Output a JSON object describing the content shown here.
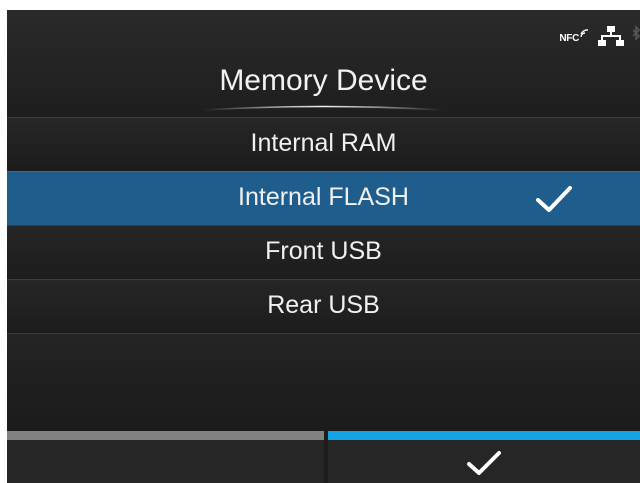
{
  "status_bar": {
    "nfc_label": "NFC",
    "icons": [
      "nfc-icon",
      "network-icon",
      "bluetooth-icon"
    ]
  },
  "header": {
    "title": "Memory Device"
  },
  "device_list": {
    "items": [
      {
        "label": "Internal RAM",
        "selected": false
      },
      {
        "label": "Internal FLASH",
        "selected": true,
        "check_icon": "checkmark-icon"
      },
      {
        "label": "Front USB",
        "selected": false
      },
      {
        "label": "Rear USB",
        "selected": false
      }
    ]
  },
  "footer": {
    "left_button": {
      "label": "",
      "icon": ""
    },
    "right_button": {
      "icon": "checkmark-icon"
    }
  },
  "colors": {
    "selected_row": "#1f5e8c",
    "confirm_accent": "#14a4e6",
    "back_accent": "#828282",
    "background": "#1d1d1d"
  }
}
